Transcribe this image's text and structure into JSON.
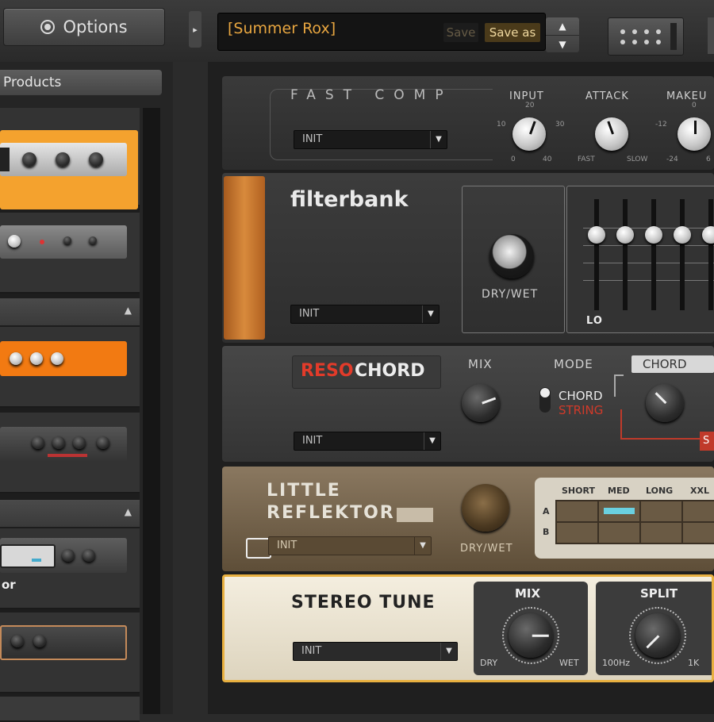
{
  "topbar": {
    "options_label": "Options",
    "collapse_glyph": "▸",
    "preset_name": "[Summer Rox]",
    "save_label": "Save",
    "save_as_label": "Save as",
    "up_glyph": "▲",
    "down_glyph": "▼"
  },
  "browser": {
    "products_label": "Products",
    "section_arrow": "▲",
    "item_label": "or",
    "thumbnails": [
      {
        "name": "orange-amp",
        "color": "#f0a030",
        "selected": true
      },
      {
        "name": "silver-amp",
        "color": "#6e6e6e"
      },
      {
        "name": "orange-pedal",
        "color": "#f07a12"
      },
      {
        "name": "dark-preamp",
        "color": "#3e3e3e"
      },
      {
        "name": "lcd-unit",
        "color": "#4a4a4a"
      },
      {
        "name": "copper-unit",
        "color": "#4a4a4a"
      }
    ]
  },
  "modules": {
    "fast_comp": {
      "title": "FAST COMP",
      "preset": "INIT",
      "input_label": "INPUT",
      "attack_label": "ATTACK",
      "makeup_label": "MAKEU",
      "input_scale": {
        "top": "20",
        "left": "10",
        "right": "30",
        "bottom_left": "0",
        "bottom_right": "40"
      },
      "attack_scale": {
        "left": "FAST",
        "right": "SLOW"
      },
      "makeup_scale": {
        "top": "0",
        "left": "-12",
        "bottom_left": "-24",
        "bottom_right": "6"
      }
    },
    "filterbank": {
      "title": "filterbank",
      "preset": "INIT",
      "drywet_label": "DRY/WET",
      "lo_label": "LO"
    },
    "resochord": {
      "title_red": "RESO",
      "title_white": "CHORD",
      "preset": "INIT",
      "mix_label": "MIX",
      "mode_label": "MODE",
      "mode_chord": "CHORD",
      "mode_string": "STRING",
      "chord_tab": "CHORD",
      "s_label": "S"
    },
    "little_reflektor": {
      "title_line1": "LITTLE",
      "title_line2": "REFLEKTOR",
      "preset": "INIT",
      "drywet_label": "DRY/WET",
      "grid_cols": [
        "SHORT",
        "MED",
        "LONG",
        "XXL"
      ],
      "grid_rows": [
        "A",
        "B"
      ]
    },
    "stereo_tune": {
      "title": "STEREO TUNE",
      "preset": "INIT",
      "mix_label": "MIX",
      "mix_left": "DRY",
      "mix_right": "WET",
      "split_label": "SPLIT",
      "split_left": "100Hz",
      "split_right": "1K"
    }
  }
}
